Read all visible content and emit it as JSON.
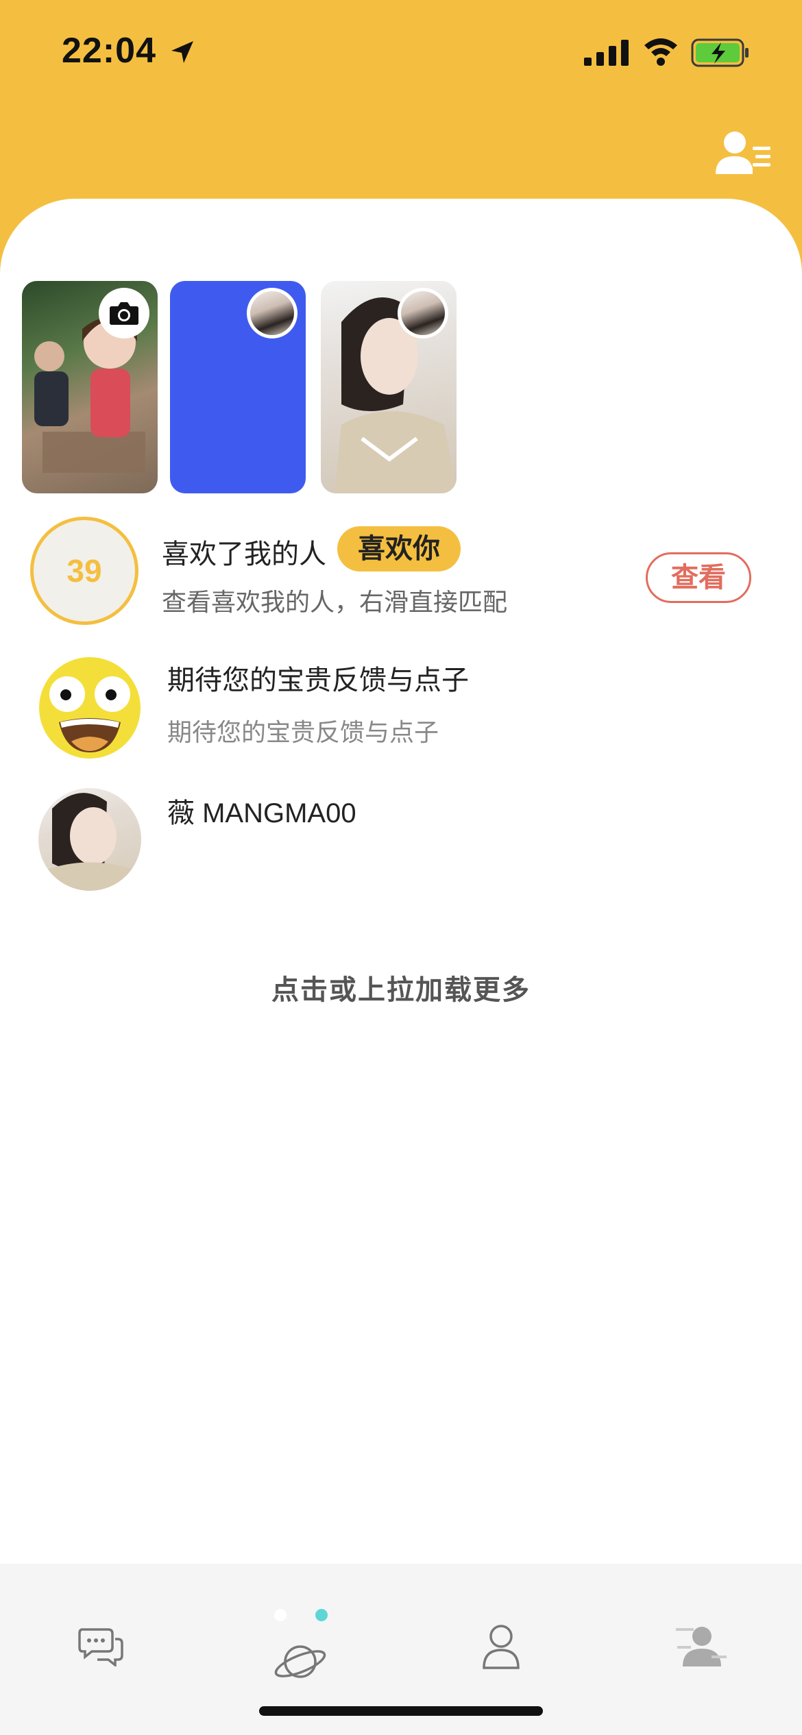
{
  "status_bar": {
    "time": "22:04",
    "icons": [
      "location-arrow-icon",
      "signal-icon",
      "wifi-icon",
      "battery-charging-icon"
    ]
  },
  "header": {
    "icon": "contacts-list-icon"
  },
  "stories": [
    {
      "name": "story-camera",
      "badge_icon": "camera-icon"
    },
    {
      "name": "story-blue",
      "color": "#3F5BEF"
    },
    {
      "name": "story-photo"
    }
  ],
  "likes_row": {
    "count": "39",
    "title": "喜欢了我的人",
    "tag": "喜欢你",
    "subtitle": "查看喜欢我的人，右滑直接匹配",
    "button": "查看"
  },
  "feedback_row": {
    "title": "期待您的宝贵反馈与点子",
    "subtitle": "期待您的宝贵反馈与点子"
  },
  "user_row": {
    "name": "薇 MANGMA00"
  },
  "load_more": "点击或上拉加载更多",
  "tabbar": {
    "tabs": [
      "chat-icon",
      "planet-icon",
      "profile-icon",
      "match-icon"
    ],
    "page_dots": 2,
    "active_dot": 2
  },
  "colors": {
    "brand_yellow": "#F4BF40",
    "accent_red": "#E26D5E",
    "dot_teal": "#5ED6D6"
  }
}
